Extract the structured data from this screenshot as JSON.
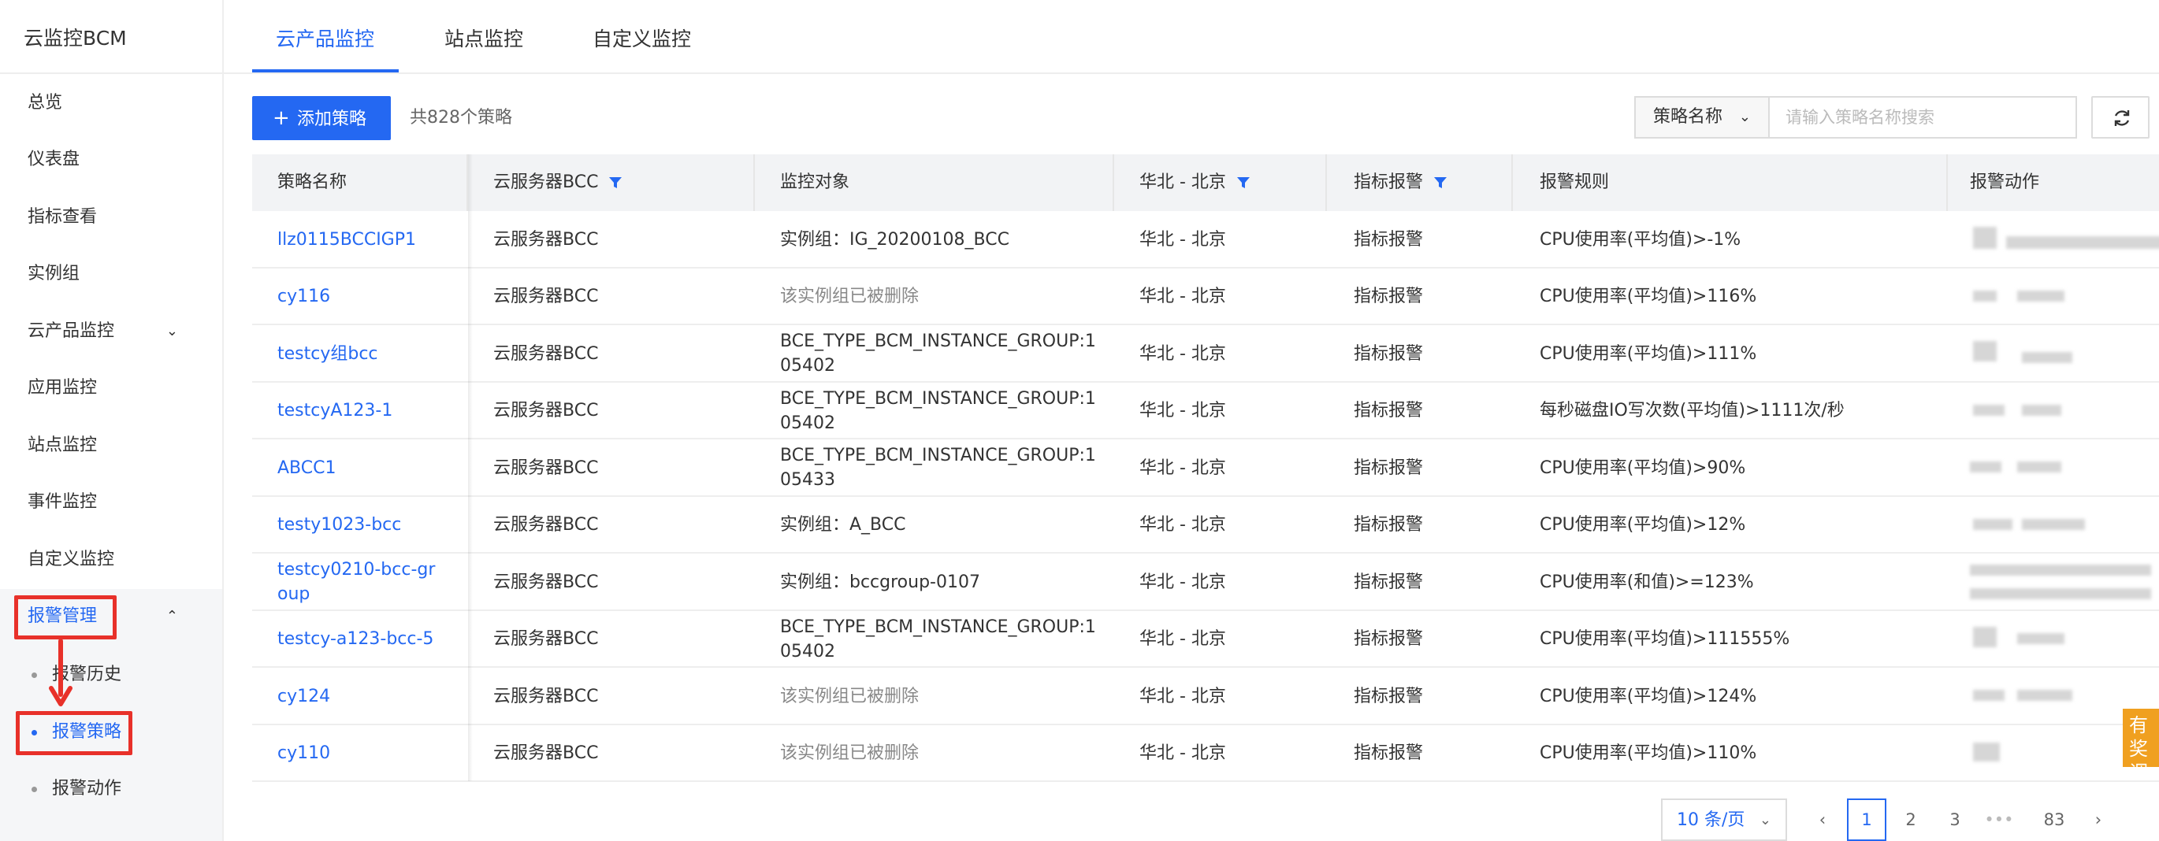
{
  "sidebar": {
    "brand": "云监控BCM",
    "items": [
      {
        "label": "总览"
      },
      {
        "label": "仪表盘"
      },
      {
        "label": "指标查看"
      },
      {
        "label": "实例组"
      },
      {
        "label": "云产品监控"
      },
      {
        "label": "应用监控"
      },
      {
        "label": "站点监控"
      },
      {
        "label": "事件监控"
      },
      {
        "label": "自定义监控"
      },
      {
        "label": "报警管理"
      }
    ],
    "sub_items": [
      {
        "label": "报警历史"
      },
      {
        "label": "报警策略"
      },
      {
        "label": "报警动作"
      }
    ]
  },
  "tabs": [
    {
      "label": "云产品监控"
    },
    {
      "label": "站点监控"
    },
    {
      "label": "自定义监控"
    }
  ],
  "toolbar": {
    "add_label": "添加策略",
    "count_text": "共828个策略",
    "filter_select": "策略名称",
    "search_placeholder": "请输入策略名称搜索"
  },
  "table": {
    "headers": [
      "策略名称",
      "云服务器BCC",
      "监控对象",
      "华北 - 北京",
      "指标报警",
      "报警规则",
      "报警动作"
    ],
    "rows": [
      {
        "name": "llz0115BCCIGP1",
        "product": "云服务器BCC",
        "object": "实例组：IG_20200108_BCC",
        "region": "华北 - 北京",
        "type": "指标报警",
        "rule": "CPU使用率(平均值)>-1%"
      },
      {
        "name": "cy116",
        "product": "云服务器BCC",
        "object": "该实例组已被删除",
        "region": "华北 - 北京",
        "type": "指标报警",
        "rule": "CPU使用率(平均值)>116%"
      },
      {
        "name": "testcy组bcc",
        "product": "云服务器BCC",
        "object": "BCE_TYPE_BCM_INSTANCE_GROUP:105402",
        "region": "华北 - 北京",
        "type": "指标报警",
        "rule": "CPU使用率(平均值)>111%"
      },
      {
        "name": "testcyA123-1",
        "product": "云服务器BCC",
        "object": "BCE_TYPE_BCM_INSTANCE_GROUP:105402",
        "region": "华北 - 北京",
        "type": "指标报警",
        "rule": "每秒磁盘IO写次数(平均值)>1111次/秒"
      },
      {
        "name": "ABCC1",
        "product": "云服务器BCC",
        "object": "BCE_TYPE_BCM_INSTANCE_GROUP:105433",
        "region": "华北 - 北京",
        "type": "指标报警",
        "rule": "CPU使用率(平均值)>90%"
      },
      {
        "name": "testy1023-bcc",
        "product": "云服务器BCC",
        "object": "实例组：A_BCC",
        "region": "华北 - 北京",
        "type": "指标报警",
        "rule": "CPU使用率(平均值)>12%"
      },
      {
        "name": "testcy0210-bcc-group",
        "product": "云服务器BCC",
        "object": "实例组：bccgroup-0107",
        "region": "华北 - 北京",
        "type": "指标报警",
        "rule": "CPU使用率(和值)>=123%"
      },
      {
        "name": "testcy-a123-bcc-5",
        "product": "云服务器BCC",
        "object": "BCE_TYPE_BCM_INSTANCE_GROUP:105402",
        "region": "华北 - 北京",
        "type": "指标报警",
        "rule": "CPU使用率(平均值)>111555%"
      },
      {
        "name": "cy124",
        "product": "云服务器BCC",
        "object": "该实例组已被删除",
        "region": "华北 - 北京",
        "type": "指标报警",
        "rule": "CPU使用率(平均值)>124%"
      },
      {
        "name": "cy110",
        "product": "云服务器BCC",
        "object": "该实例组已被删除",
        "region": "华北 - 北京",
        "type": "指标报警",
        "rule": "CPU使用率(平均值)>110%"
      }
    ]
  },
  "pagination": {
    "page_size": "10 条/页",
    "pages": [
      "1",
      "2",
      "3",
      "•••",
      "83"
    ],
    "prev": "‹",
    "next": "›"
  },
  "float_tag": "有奖调研",
  "colors": {
    "accent": "#2468f2",
    "annotation": "#e8312a"
  }
}
